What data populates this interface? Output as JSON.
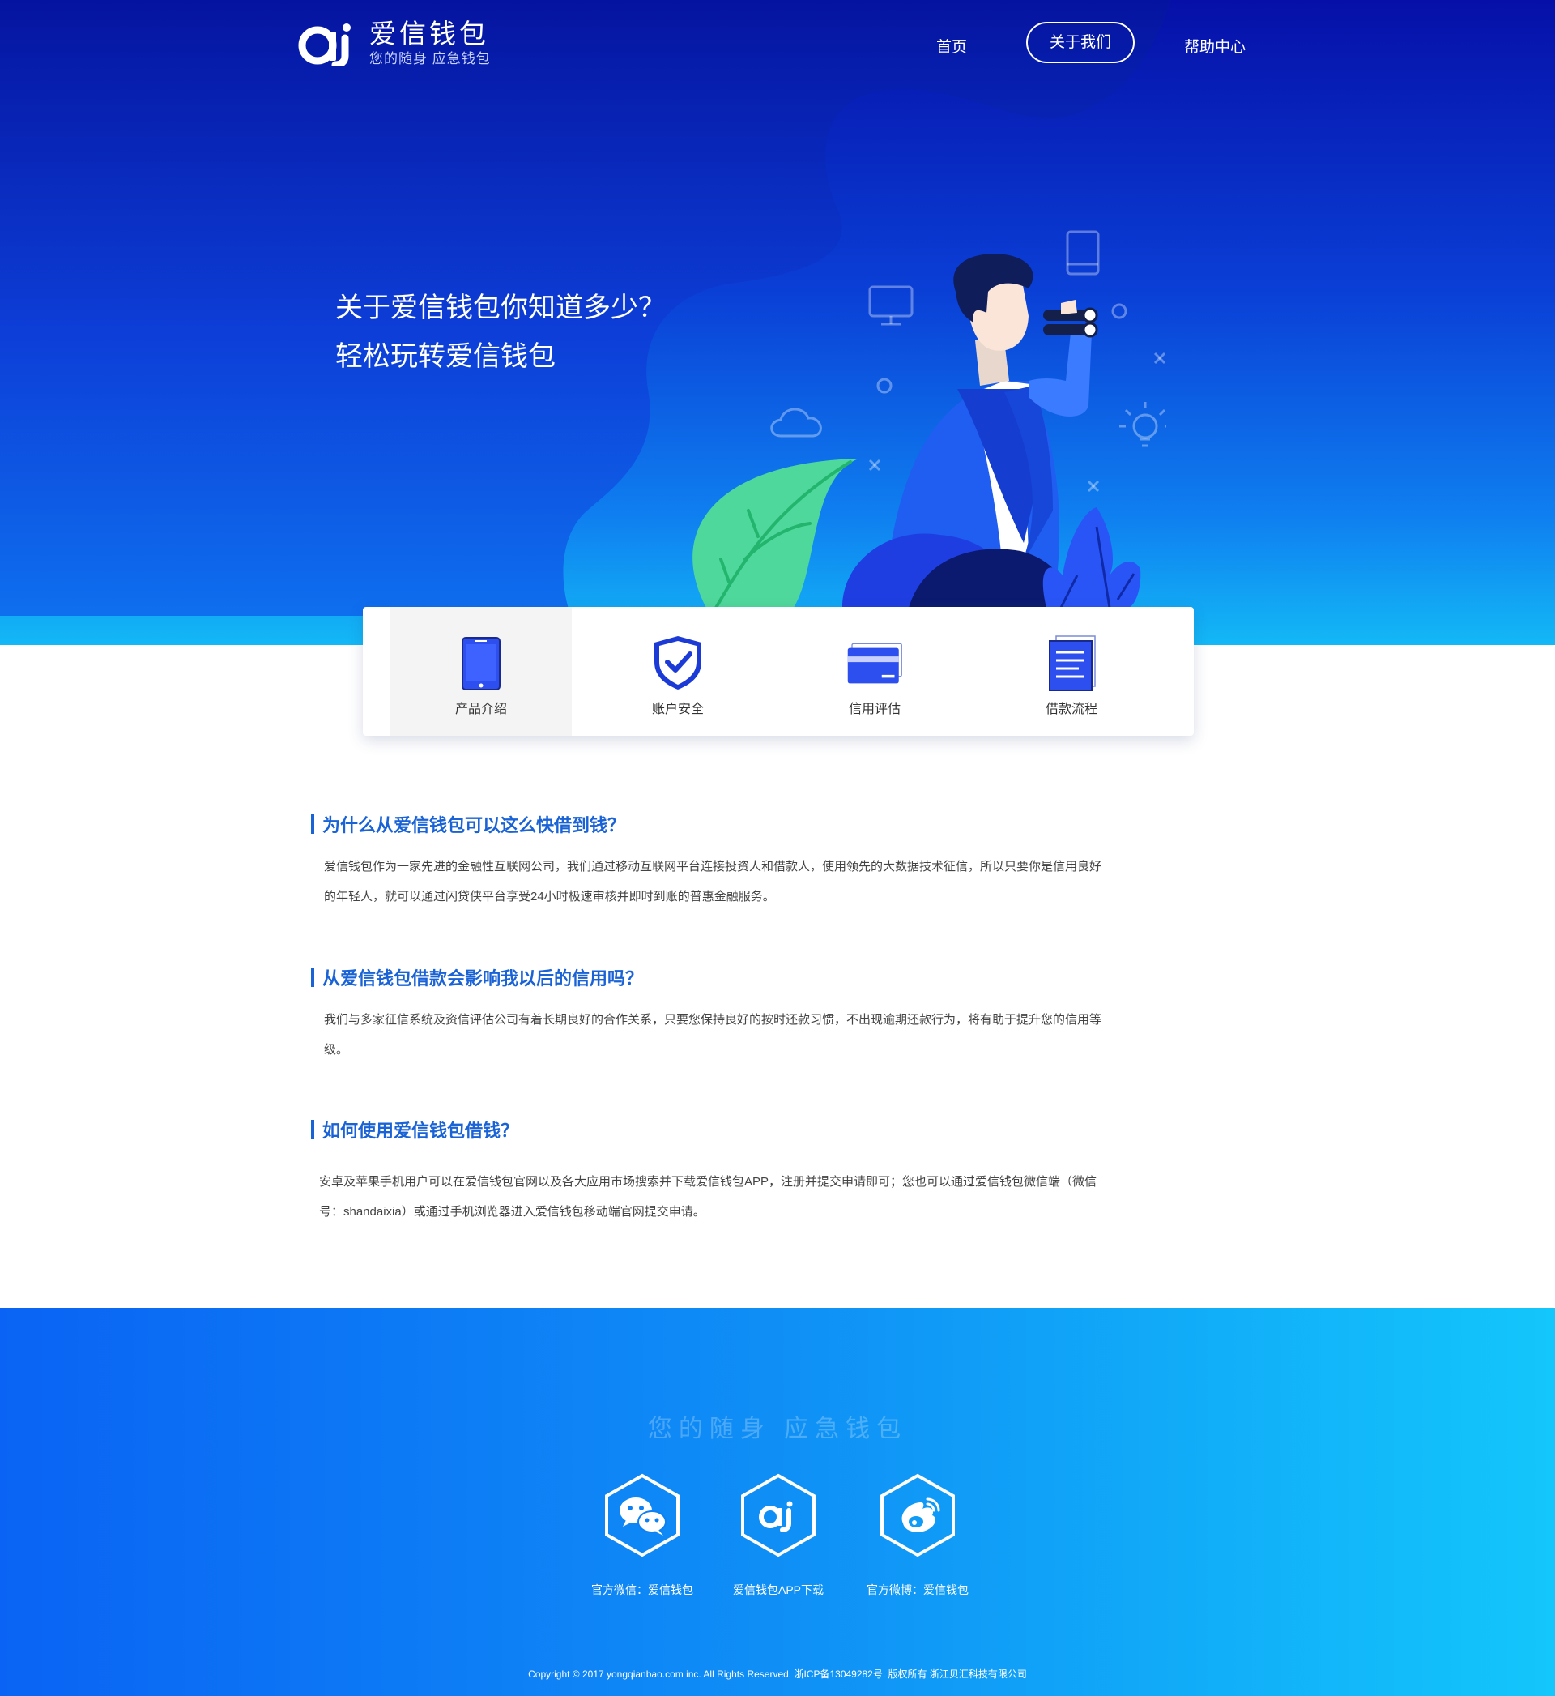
{
  "brand": {
    "name": "爱信钱包",
    "slogan": "您的随身 应急钱包"
  },
  "nav": {
    "home": "首页",
    "about": "关于我们",
    "help": "帮助中心"
  },
  "hero": {
    "line1": "关于爱信钱包你知道多少？",
    "line2": "轻松玩转爱信钱包"
  },
  "features": [
    {
      "label": "产品介绍",
      "icon": "phone-icon"
    },
    {
      "label": "账户安全",
      "icon": "shield-check-icon"
    },
    {
      "label": "信用评估",
      "icon": "credit-card-icon"
    },
    {
      "label": "借款流程",
      "icon": "document-icon"
    }
  ],
  "faq": [
    {
      "question": "为什么从爱信钱包可以这么快借到钱？",
      "answer": "爱信钱包作为一家先进的金融性互联网公司，我们通过移动互联网平台连接投资人和借款人，使用领先的大数据技术征信，所以只要你是信用良好的年轻人，就可以通过闪贷侠平台享受24小时极速审核并即时到账的普惠金融服务。"
    },
    {
      "question": "从爱信钱包借款会影响我以后的信用吗？",
      "answer": "我们与多家征信系统及资信评估公司有着长期良好的合作关系，只要您保持良好的按时还款习惯，不出现逾期还款行为，将有助于提升您的信用等级。"
    },
    {
      "question": "如何使用爱信钱包借钱？",
      "answer": "安卓及苹果手机用户可以在爱信钱包官网以及各大应用市场搜索并下载爱信钱包APP，注册并提交申请即可；您也可以通过爱信钱包微信端（微信号：shandaixia）或通过手机浏览器进入爱信钱包移动端官网提交申请。"
    }
  ],
  "footer": {
    "slogan": "您的随身 应急钱包",
    "social": [
      {
        "label": "官方微信：爱信钱包",
        "icon": "wechat-icon"
      },
      {
        "label": "爱信钱包APP下载",
        "icon": "app-logo-icon"
      },
      {
        "label": "官方微博：爱信钱包",
        "icon": "weibo-icon"
      }
    ],
    "copyright": "Copyright © 2017 yongqianbao.com inc. All Rights Reserved. 浙ICP备13049282号. 版权所有 浙江贝汇科技有限公司"
  }
}
